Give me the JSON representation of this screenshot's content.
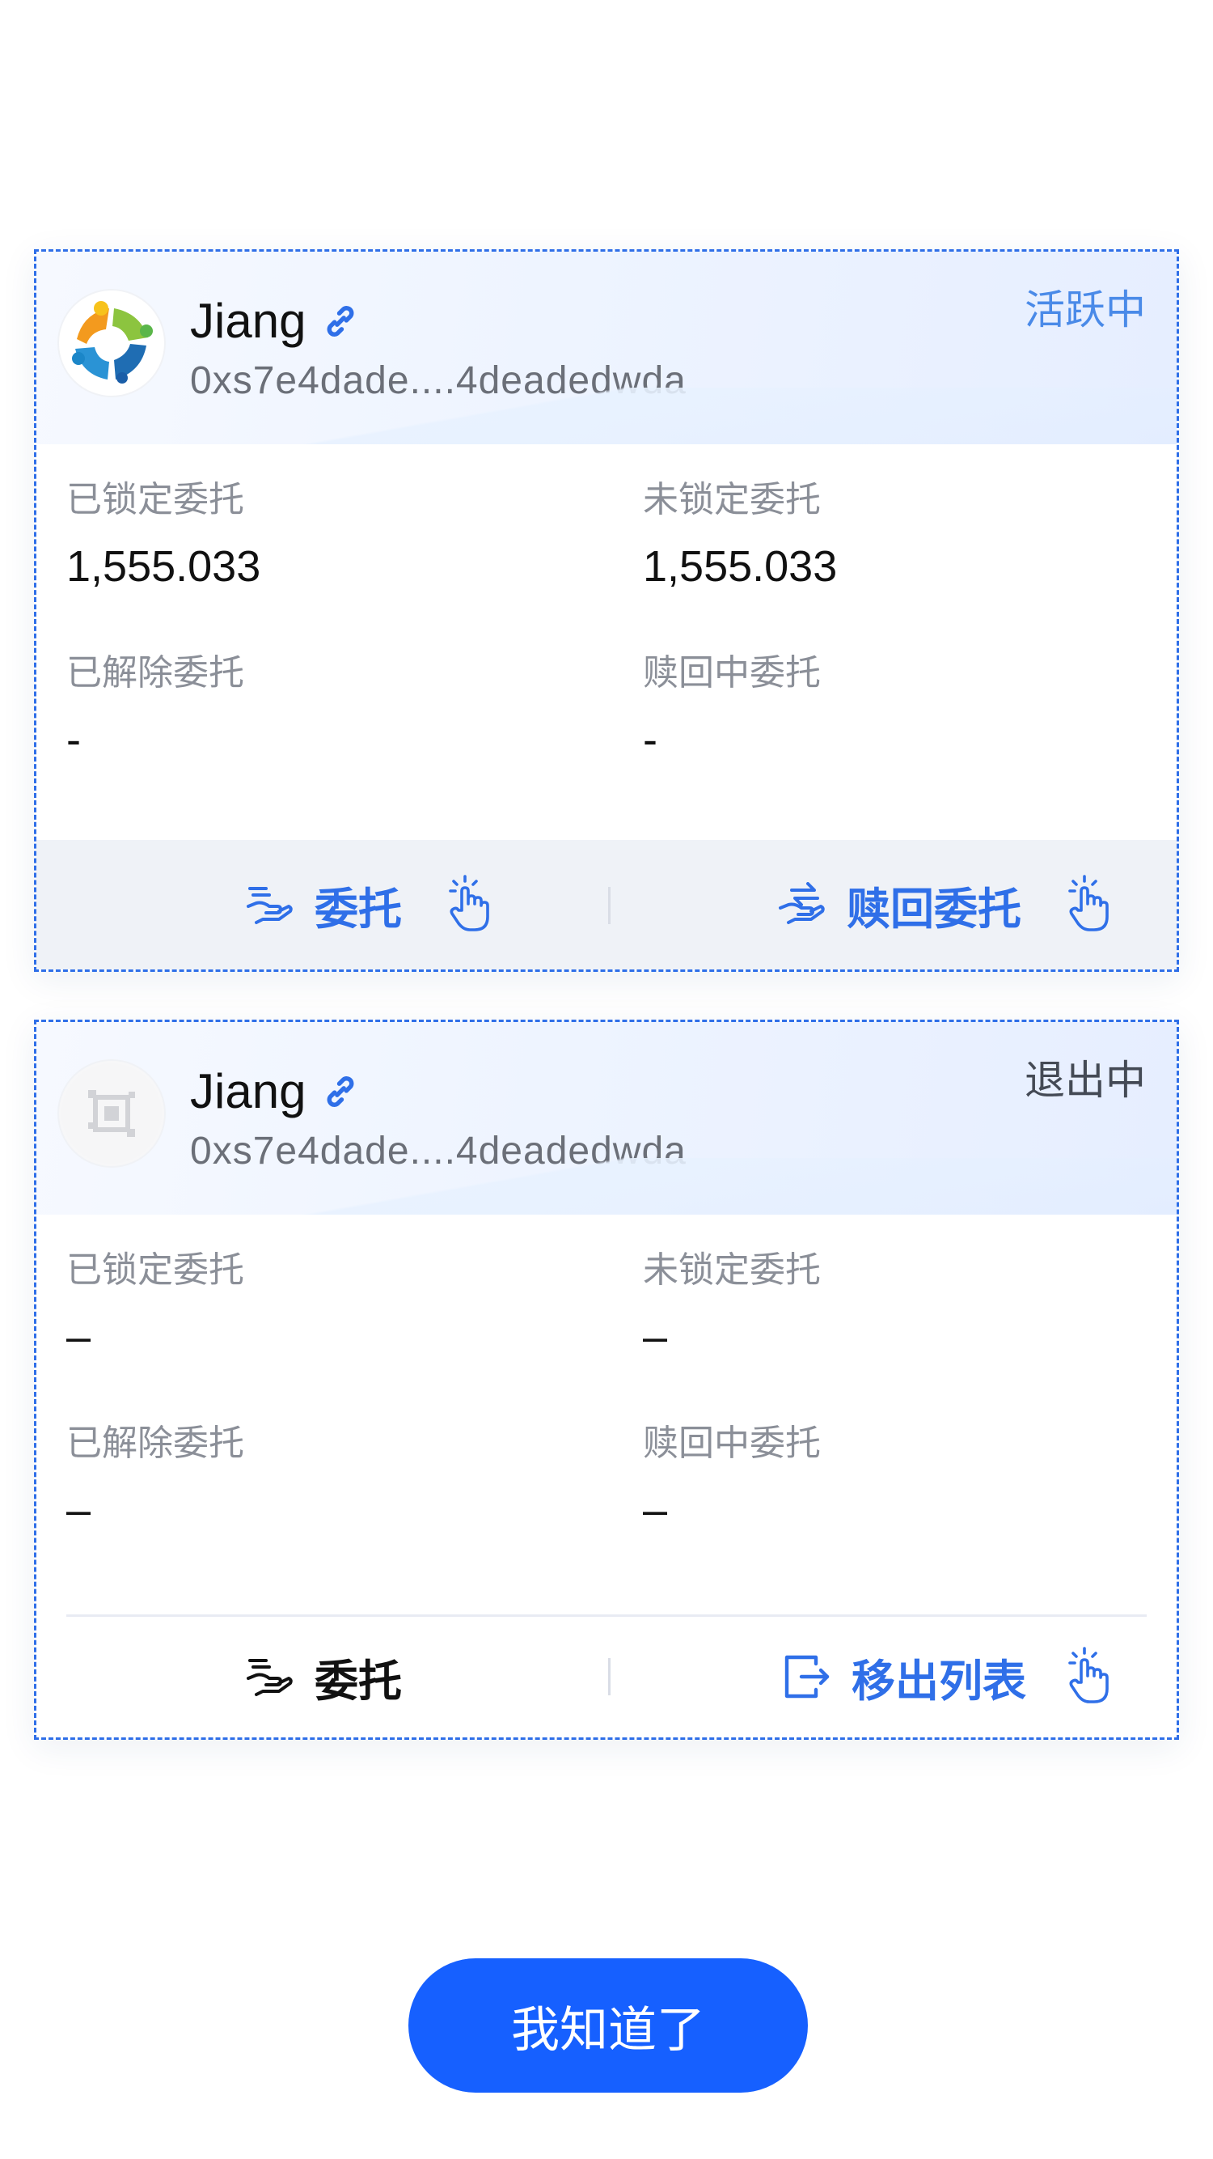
{
  "colors": {
    "accent": "#1660ff",
    "link_blue": "#2f6fe8",
    "active_status": "#4a8ae8",
    "exiting_status": "#444a55"
  },
  "validators": [
    {
      "name": "Jiang",
      "address": "0xs7e4dade....4deadedwda",
      "status": "活跃中",
      "stats": {
        "locked_label": "已锁定委托",
        "locked_value": "1,555.033",
        "unlocked_label": "未锁定委托",
        "unlocked_value": "1,555.033",
        "released_label": "已解除委托",
        "released_value": "-",
        "redeeming_label": "赎回中委托",
        "redeeming_value": "-"
      },
      "actions": {
        "left_label": "委托",
        "right_label": "赎回委托"
      }
    },
    {
      "name": "Jiang",
      "address": "0xs7e4dade....4deadedwda",
      "status": "退出中",
      "stats": {
        "locked_label": "已锁定委托",
        "locked_value": "–",
        "unlocked_label": "未锁定委托",
        "unlocked_value": "–",
        "released_label": "已解除委托",
        "released_value": "–",
        "redeeming_label": "赎回中委托",
        "redeeming_value": "–"
      },
      "actions": {
        "left_label": "委托",
        "right_label": "移出列表"
      }
    }
  ],
  "footer": {
    "confirm_label": "我知道了"
  }
}
